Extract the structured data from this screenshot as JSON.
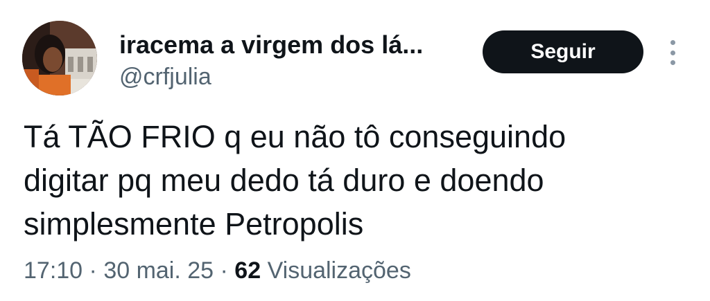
{
  "author": {
    "display_name": "iracema a virgem dos lá...",
    "handle": "@crfjulia",
    "avatar": "profile-photo"
  },
  "follow_button": {
    "label": "Seguir"
  },
  "more_menu": {
    "icon": "more-vertical-icon"
  },
  "tweet": {
    "lines": [
      "Tá TÃO FRIO q eu não tô conseguindo",
      "digitar pq meu dedo tá duro e doendo",
      "simplesmente Petropolis"
    ]
  },
  "meta": {
    "time": "17:10",
    "separator": " · ",
    "date": "30 mai. 25",
    "views_count": "62",
    "views_label": " Visualizações"
  },
  "colors": {
    "text_primary": "#0f1419",
    "text_secondary": "#536471",
    "button_bg": "#0f1419",
    "button_text": "#ffffff"
  }
}
